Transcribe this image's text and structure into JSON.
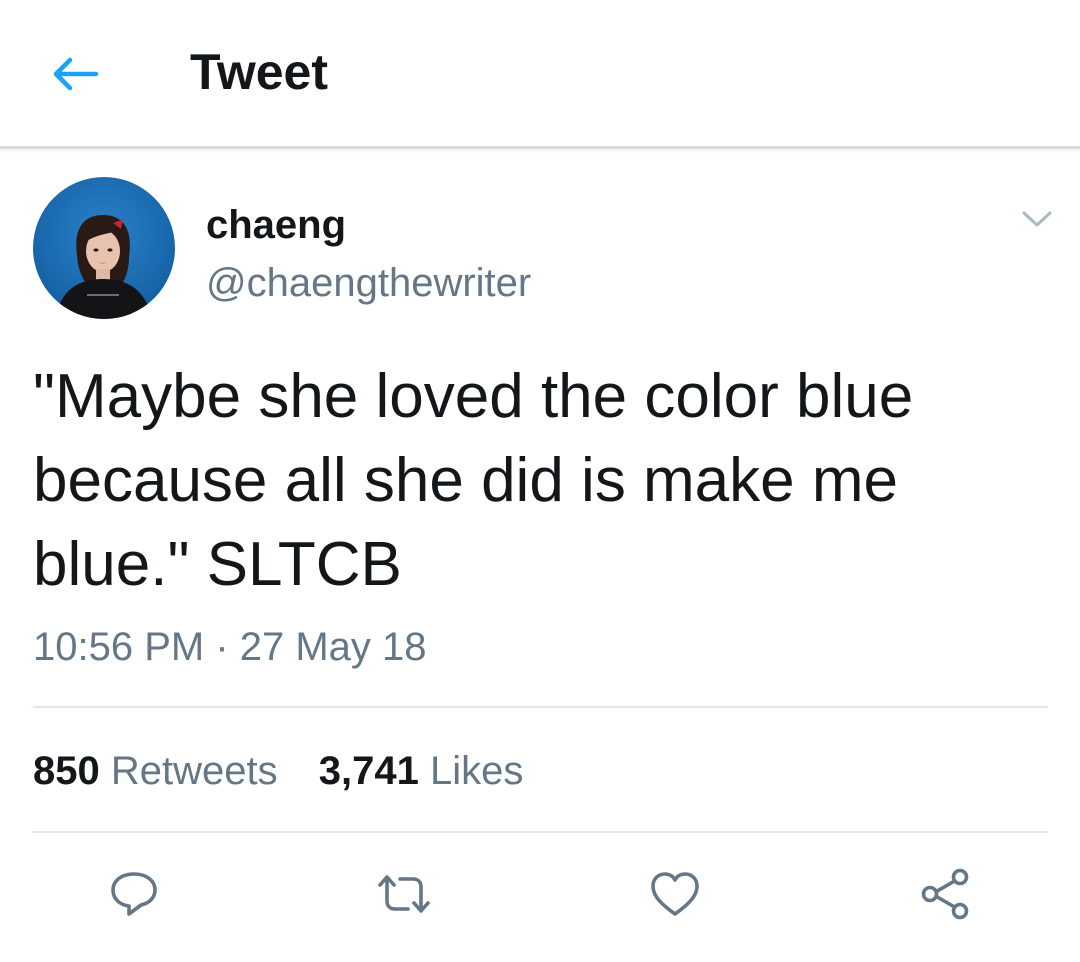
{
  "app_bar": {
    "title": "Tweet",
    "back_icon": "arrow-left-icon",
    "accent": "#1da1f2"
  },
  "tweet": {
    "author": {
      "display_name": "chaeng",
      "handle": "@chaengthewriter",
      "avatar_background": "#1c6fb8"
    },
    "text_lines": [
      "\"Maybe she loved the color blue",
      "because all she did is make me",
      "blue.\" SLTCB"
    ],
    "timestamp": "10:56 PM · 27 May 18",
    "stats": {
      "retweets_count": "850",
      "retweets_label": "Retweets",
      "likes_count": "3,741",
      "likes_label": "Likes"
    },
    "actions": {
      "reply_icon": "reply-icon",
      "retweet_icon": "retweet-icon",
      "like_icon": "heart-icon",
      "share_icon": "share-icon"
    }
  },
  "colors": {
    "text_primary": "#14171a",
    "text_secondary": "#657786",
    "divider": "#e1e8ed",
    "icon_gray": "#657786"
  }
}
